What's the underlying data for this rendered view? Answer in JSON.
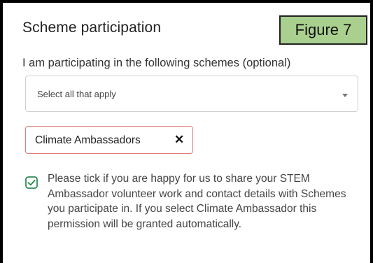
{
  "figure_label": "Figure 7",
  "section": {
    "title": "Scheme participation"
  },
  "schemes_field": {
    "label": "I am participating in the following schemes (optional)",
    "placeholder": "Select all that apply",
    "selected_chips": [
      {
        "label": "Climate Ambassadors",
        "remove_icon": "close-icon"
      }
    ]
  },
  "consent": {
    "checked": true,
    "text": "Please tick if you are happy for us to share your STEM Ambassador volunteer work and contact details with Schemes you participate in. If you select Climate Ambassador this permission will be granted automatically."
  },
  "colors": {
    "accent_green": "#2e8b57",
    "figure_label_bg": "#a9d08e",
    "chip_border": "#e07b7b",
    "frame": "#000000"
  }
}
